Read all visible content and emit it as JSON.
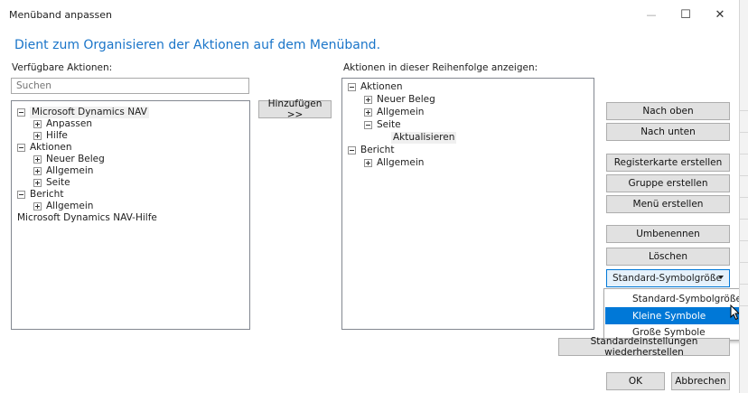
{
  "window": {
    "title": "Menüband anpassen",
    "minimize_glyph": "—",
    "maximize_glyph": "☐",
    "close_glyph": "✕"
  },
  "heading": "Dient zum Organisieren der Aktionen auf dem Menüband.",
  "left_panel": {
    "label": "Verfügbare Aktionen:",
    "search_placeholder": "Suchen",
    "tree": [
      {
        "label": "Microsoft Dynamics NAV",
        "expander": "minus"
      },
      {
        "label": "Anpassen",
        "expander": "plus"
      },
      {
        "label": "Hilfe",
        "expander": "plus"
      },
      {
        "label": "Aktionen",
        "expander": "minus"
      },
      {
        "label": "Neuer Beleg",
        "expander": "plus"
      },
      {
        "label": "Allgemein",
        "expander": "plus"
      },
      {
        "label": "Seite",
        "expander": "plus"
      },
      {
        "label": "Bericht",
        "expander": "minus"
      },
      {
        "label": "Allgemein",
        "expander": "plus"
      },
      {
        "label": "Microsoft Dynamics NAV-Hilfe",
        "expander": "none"
      }
    ]
  },
  "add_button": "Hinzufügen >>",
  "right_panel": {
    "label": "Aktionen in dieser Reihenfolge anzeigen:",
    "tree": [
      {
        "label": "Aktionen",
        "expander": "minus"
      },
      {
        "label": "Neuer Beleg",
        "expander": "plus"
      },
      {
        "label": "Allgemein",
        "expander": "plus"
      },
      {
        "label": "Seite",
        "expander": "minus"
      },
      {
        "label": "Aktualisieren",
        "expander": "none"
      },
      {
        "label": "Bericht",
        "expander": "minus"
      },
      {
        "label": "Allgemein",
        "expander": "plus"
      }
    ]
  },
  "buttons": {
    "move_up": "Nach oben",
    "move_down": "Nach unten",
    "create_tab": "Registerkarte erstellen",
    "create_group": "Gruppe erstellen",
    "create_menu": "Menü erstellen",
    "rename": "Umbenennen",
    "delete": "Löschen",
    "reset": "Standardeinstellungen wiederherstellen",
    "ok": "OK",
    "cancel": "Abbrechen"
  },
  "icon_size_select": {
    "value": "Standard-Symbolgröße",
    "options": [
      "Standard-Symbolgröße",
      "Kleine Symbole",
      "Große Symbole"
    ],
    "highlighted": "Kleine Symbole"
  },
  "colors": {
    "heading": "#1a75c9",
    "selection": "#0078d7"
  }
}
